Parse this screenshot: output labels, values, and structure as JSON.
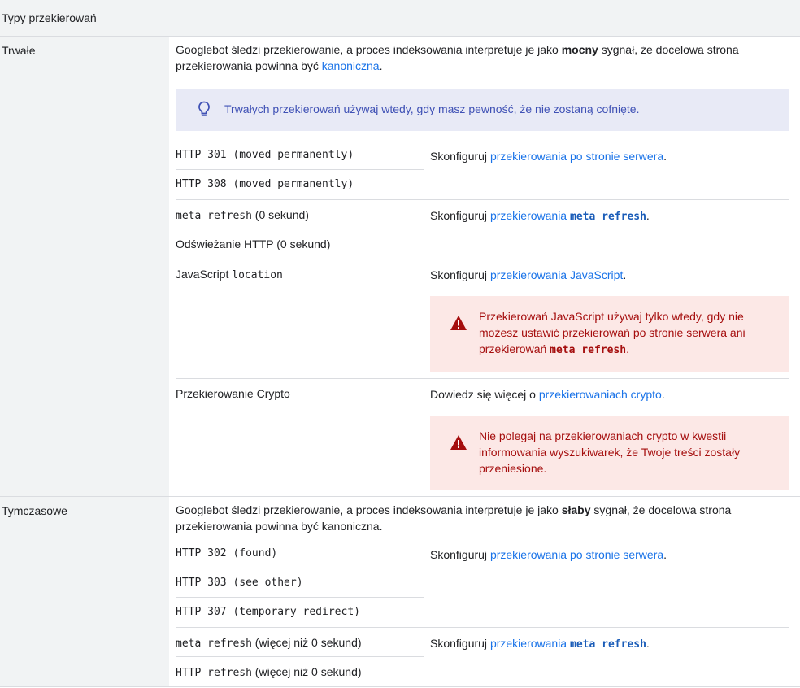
{
  "header": {
    "title": "Typy przekierowań"
  },
  "permanent": {
    "label": "Trwałe",
    "intro_pre": "Googlebot śledzi przekierowanie, a proces indeksowania interpretuje je jako ",
    "intro_bold": "mocny",
    "intro_mid": " sygnał, że docelowa strona przekierowania powinna być ",
    "intro_link": "kanoniczna",
    "intro_end": ".",
    "note": "Trwałych przekierowań używaj wtedy, gdy masz pewność, że nie zostaną cofnięte.",
    "http301": "HTTP 301 (moved permanently)",
    "http308": "HTTP 308 (moved permanently)",
    "server_pre": "Skonfiguruj ",
    "server_link": "przekierowania po stronie serwera",
    "server_end": ".",
    "meta_code": "meta refresh",
    "meta_suffix": " (0 sekund)",
    "http_refresh": "Odświeżanie HTTP (0 sekund)",
    "meta_conf_pre": "Skonfiguruj ",
    "meta_conf_link": "przekierowania ",
    "meta_conf_code": "meta refresh",
    "meta_conf_end": ".",
    "js_pre": "JavaScript ",
    "js_code": "location",
    "js_conf_pre": "Skonfiguruj ",
    "js_conf_link": "przekierowania JavaScript",
    "js_conf_end": ".",
    "js_warn_pre": "Przekierowań JavaScript używaj tylko wtedy, gdy nie możesz ustawić przekierowań po stronie serwera ani przekierowań ",
    "js_warn_code": "meta refresh",
    "js_warn_end": ".",
    "crypto": "Przekierowanie Crypto",
    "crypto_pre": "Dowiedz się więcej o ",
    "crypto_link": "przekierowaniach crypto",
    "crypto_end": ".",
    "crypto_warn": "Nie polegaj na przekierowaniach crypto w kwestii informowania wyszukiwarek, że Twoje treści zostały przeniesione."
  },
  "temporary": {
    "label": "Tymczasowe",
    "intro_pre": "Googlebot śledzi przekierowanie, a proces indeksowania interpretuje je jako ",
    "intro_bold": "słaby",
    "intro_end": " sygnał, że docelowa strona przekierowania powinna być kanoniczna.",
    "http302": "HTTP 302 (found)",
    "http303": "HTTP 303 (see other)",
    "http307": "HTTP 307 (temporary redirect)",
    "server_pre": "Skonfiguruj ",
    "server_link": "przekierowania po stronie serwera",
    "server_end": ".",
    "meta_code": "meta refresh",
    "meta_suffix": " (więcej niż 0 sekund)",
    "http_code": "HTTP refresh",
    "http_suffix": " (więcej niż 0 sekund)",
    "meta_conf_pre": "Skonfiguruj ",
    "meta_conf_link": "przekierowania ",
    "meta_conf_code": "meta refresh",
    "meta_conf_end": "."
  },
  "colors": {
    "link": "#1a73e8",
    "note_bg": "#e8eaf6",
    "note_text": "#3f51b5",
    "warning_bg": "#fce8e6",
    "warning_text": "#a50e0e",
    "header_bg": "#f1f3f4"
  },
  "icons": {
    "note": "lightbulb-icon",
    "warning": "warning-icon"
  }
}
